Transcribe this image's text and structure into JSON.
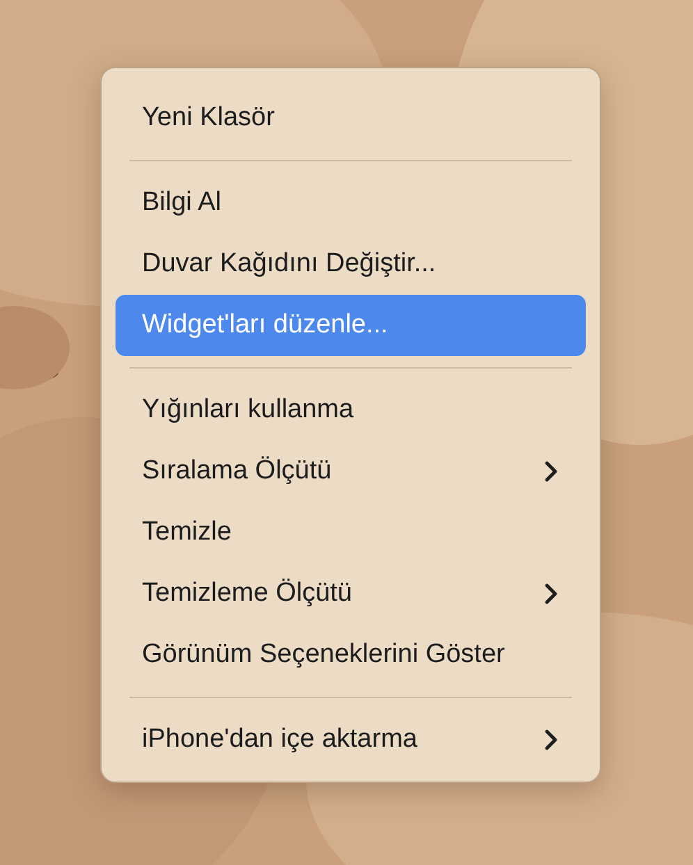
{
  "menu": {
    "items": [
      {
        "kind": "item",
        "label": "Yeni Klasör",
        "selected": false,
        "submenu": false
      },
      {
        "kind": "separator"
      },
      {
        "kind": "item",
        "label": "Bilgi Al",
        "selected": false,
        "submenu": false
      },
      {
        "kind": "item",
        "label": "Duvar Kağıdını Değiştir...",
        "selected": false,
        "submenu": false
      },
      {
        "kind": "item",
        "label": "Widget'ları düzenle...",
        "selected": true,
        "submenu": false
      },
      {
        "kind": "separator"
      },
      {
        "kind": "item",
        "label": "Yığınları kullanma",
        "selected": false,
        "submenu": false
      },
      {
        "kind": "item",
        "label": "Sıralama Ölçütü",
        "selected": false,
        "submenu": true
      },
      {
        "kind": "item",
        "label": "Temizle",
        "selected": false,
        "submenu": false
      },
      {
        "kind": "item",
        "label": "Temizleme Ölçütü",
        "selected": false,
        "submenu": true
      },
      {
        "kind": "item",
        "label": "Görünüm Seçeneklerini Göster",
        "selected": false,
        "submenu": false
      },
      {
        "kind": "separator"
      },
      {
        "kind": "item",
        "label": "iPhone'dan içe aktarma",
        "selected": false,
        "submenu": true
      }
    ]
  }
}
